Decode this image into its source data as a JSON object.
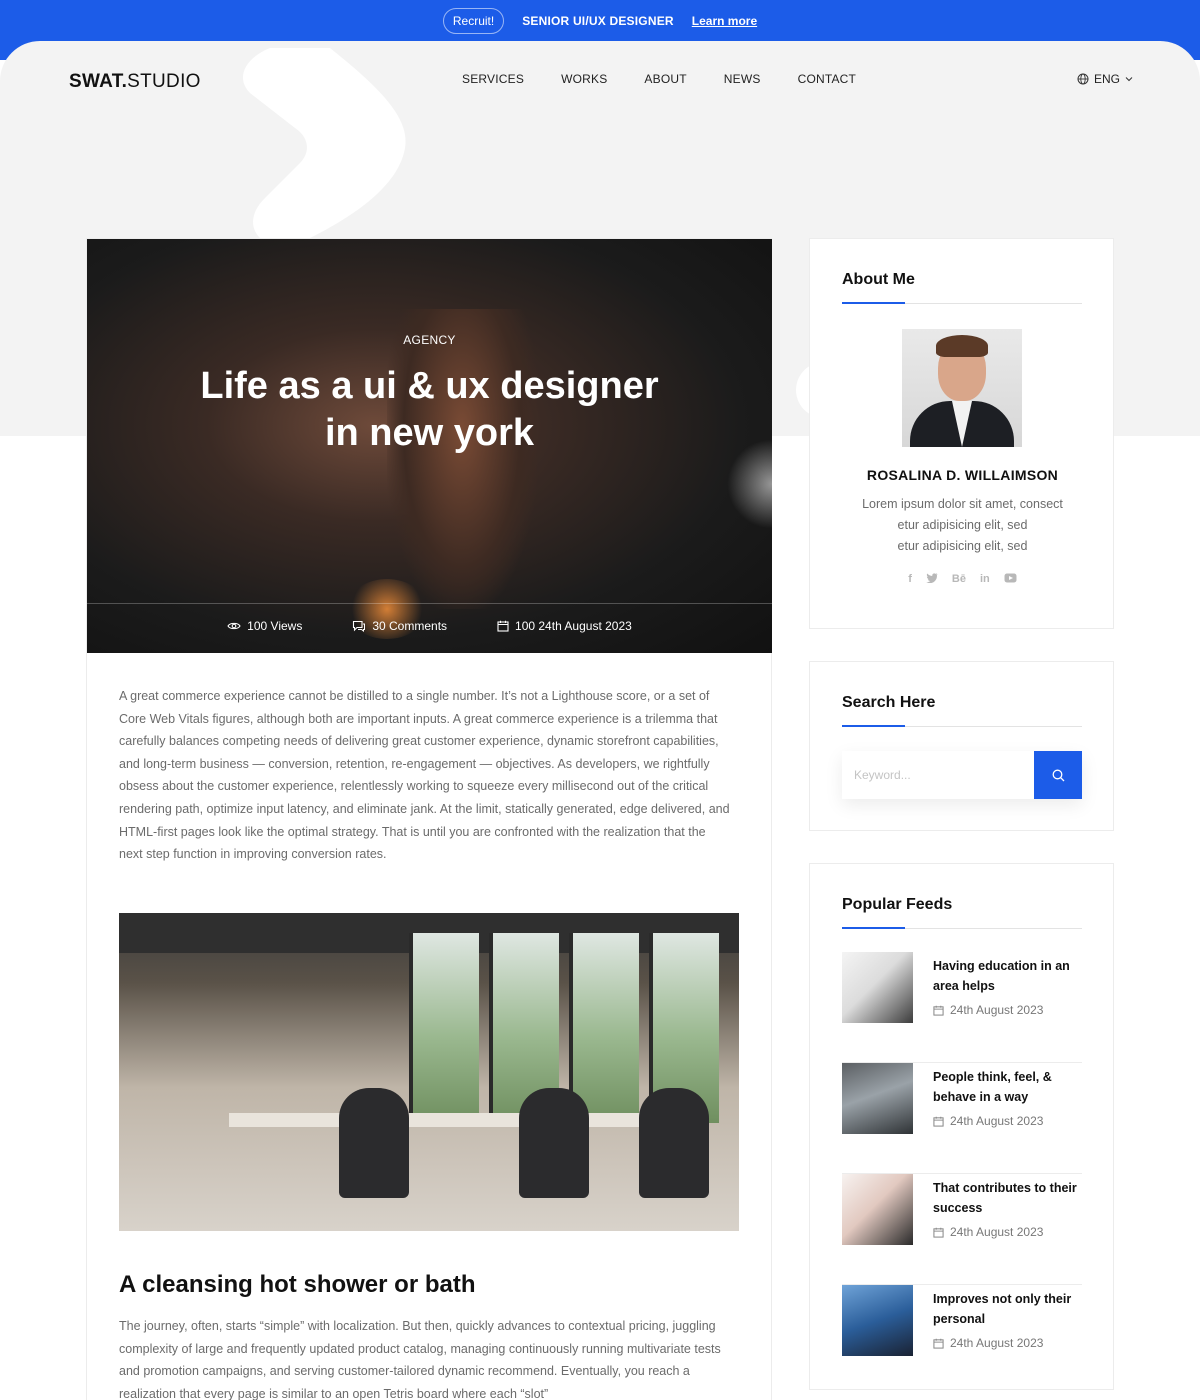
{
  "topbar": {
    "pill": "Recruit!",
    "title": "SENIOR UI/UX DESIGNER",
    "link": "Learn more"
  },
  "header": {
    "logo_bold": "SWAT.",
    "logo_light": "STUDIO",
    "nav": [
      "SERVICES",
      "WORKS",
      "ABOUT",
      "NEWS",
      "CONTACT"
    ],
    "language": "ENG"
  },
  "article": {
    "category": "AGENCY",
    "title_line1": "Life as a ui & ux designer",
    "title_line2": "in new york",
    "views": "100 Views",
    "comments": "30 Comments",
    "date": "100 24th August 2023",
    "paragraph1": "A great commerce experience cannot be distilled to a single number. It’s not a Lighthouse score, or a set of Core Web Vitals figures, although both are important inputs. A great commerce experience is a trilemma that carefully balances competing needs of delivering great customer experience, dynamic storefront capabilities, and long-term business — conversion, retention, re-engagement — objectives. As developers, we rightfully obsess about the customer experience, relentlessly working to squeeze every millisecond out of the critical rendering path, optimize input latency, and eliminate jank. At the limit, statically generated, edge delivered, and HTML-first pages look like the optimal strategy. That is until you are confronted with the realization that the next step function in improving conversion rates.",
    "heading2": "A cleansing hot shower or bath",
    "paragraph2": "The journey, often, starts “simple” with localization. But then, quickly advances to contextual pricing, juggling complexity of large and frequently updated product catalog, managing continuously running multivariate tests and promotion campaigns, and serving customer-tailored dynamic recommend. Eventually, you reach a realization that every page is similar to an open Tetris board where each “slot”"
  },
  "about": {
    "title": "About Me",
    "name": "ROSALINA D. WILLAIMSON",
    "bio_line1": "Lorem ipsum dolor sit amet, consect",
    "bio_line2": "etur adipisicing elit, sed",
    "bio_line3": "etur adipisicing elit, sed",
    "socials": [
      "f",
      "t",
      "Bē",
      "in",
      "▶"
    ]
  },
  "search": {
    "title": "Search Here",
    "placeholder": "Keyword..."
  },
  "popular": {
    "title": "Popular Feeds",
    "items": [
      {
        "title": "Having education in an area helps",
        "date": "24th August 2023"
      },
      {
        "title": "People think, feel, & behave in a way",
        "date": "24th August 2023"
      },
      {
        "title": "That contributes to their success",
        "date": "24th August 2023"
      },
      {
        "title": "Improves not only their personal",
        "date": "24th August 2023"
      }
    ]
  },
  "colors": {
    "accent": "#1c5ce8",
    "hero_background": "#f3f3f3"
  }
}
